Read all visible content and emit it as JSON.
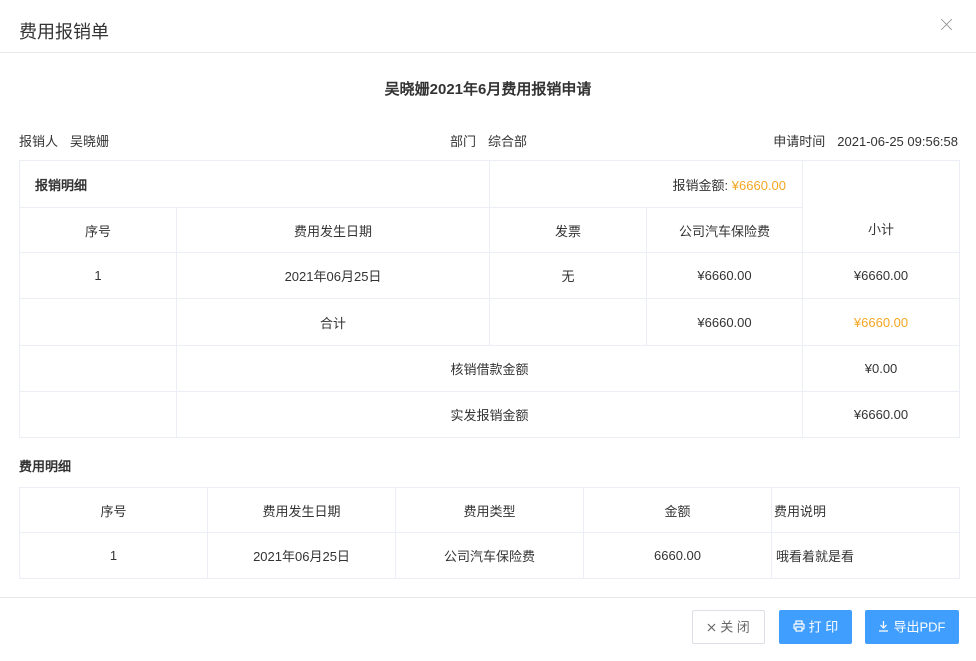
{
  "dialog": {
    "title": "费用报销单"
  },
  "document": {
    "title": "吴晓姗2021年6月费用报销申请",
    "applicant_label": "报销人",
    "applicant": "吴晓姗",
    "dept_label": "部门",
    "dept": "综合部",
    "time_label": "申请时间",
    "time": "2021-06-25 09:56:58"
  },
  "summary": {
    "section_title": "报销明细",
    "amount_label": "报销金额:",
    "amount": "¥6660.00",
    "headers": [
      "序号",
      "费用发生日期",
      "发票",
      "公司汽车保险费",
      "小计"
    ],
    "row": {
      "index": "1",
      "date": "2021年06月25日",
      "invoice": "无",
      "insurance": "¥6660.00",
      "subtotal": "¥6660.00"
    },
    "total": {
      "label": "合计",
      "insurance": "¥6660.00",
      "subtotal": "¥6660.00"
    },
    "writeoff": {
      "label": "核销借款金额",
      "value": "¥0.00"
    },
    "actual": {
      "label": "实发报销金额",
      "value": "¥6660.00"
    }
  },
  "detail": {
    "section_title": "费用明细",
    "headers": [
      "序号",
      "费用发生日期",
      "费用类型",
      "金额",
      "费用说明"
    ],
    "row": {
      "index": "1",
      "date": "2021年06月25日",
      "type": "公司汽车保险费",
      "amount": "6660.00",
      "note": "哦看着就是看"
    }
  },
  "footer": {
    "close_label": "关 闭",
    "print_label": "打 印",
    "pdf_label": "导出PDF"
  },
  "colors": {
    "accent": "#409eff",
    "amount": "#f5a623",
    "border": "#ebeef5"
  }
}
